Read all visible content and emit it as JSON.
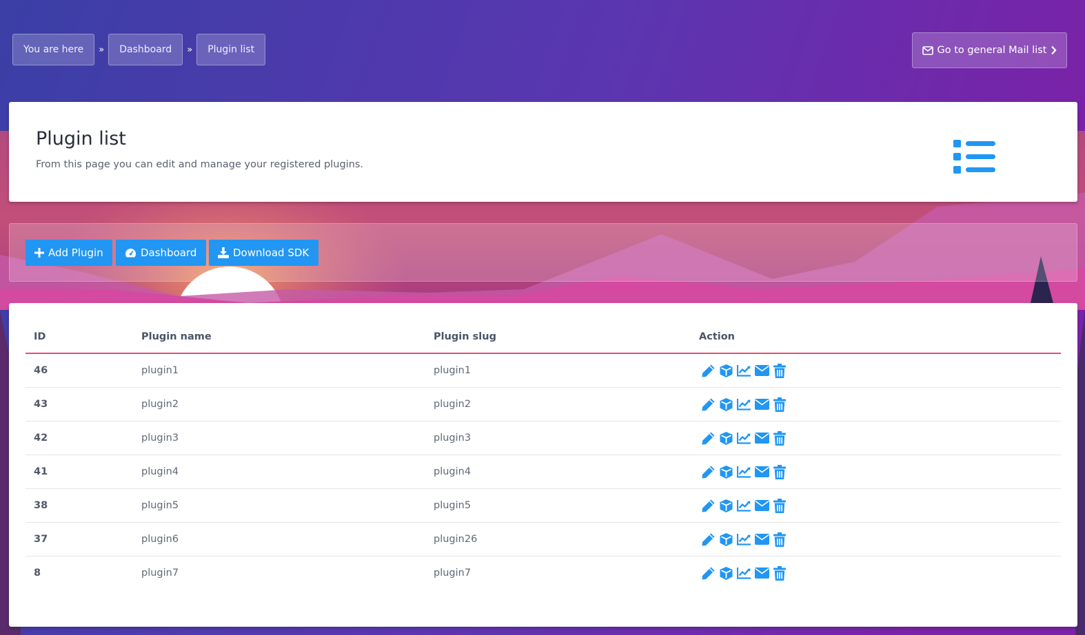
{
  "breadcrumb": {
    "items": [
      "You are here",
      "Dashboard",
      "Plugin list"
    ],
    "separator": "»"
  },
  "mail_button": {
    "label": "Go to general Mail list"
  },
  "header": {
    "title": "Plugin list",
    "subtitle": "From this page you can edit and manage your registered plugins."
  },
  "toolbar": {
    "add_label": "Add Plugin",
    "dashboard_label": "Dashboard",
    "sdk_label": "Download SDK"
  },
  "table": {
    "columns": [
      "ID",
      "Plugin name",
      "Plugin slug",
      "Action"
    ],
    "rows": [
      {
        "id": "46",
        "name": "plugin1",
        "slug": "plugin1"
      },
      {
        "id": "43",
        "name": "plugin2",
        "slug": "plugin2"
      },
      {
        "id": "42",
        "name": "plugin3",
        "slug": "plugin3"
      },
      {
        "id": "41",
        "name": "plugin4",
        "slug": "plugin4"
      },
      {
        "id": "38",
        "name": "plugin5",
        "slug": "plugin5"
      },
      {
        "id": "37",
        "name": "plugin6",
        "slug": "plugin26"
      },
      {
        "id": "8",
        "name": "plugin7",
        "slug": "plugin7"
      }
    ],
    "action_icons": [
      "edit-icon",
      "package-icon",
      "stats-icon",
      "mail-icon",
      "trash-icon"
    ]
  },
  "colors": {
    "accent": "#2196f3",
    "table_rule": "#e84a73"
  }
}
